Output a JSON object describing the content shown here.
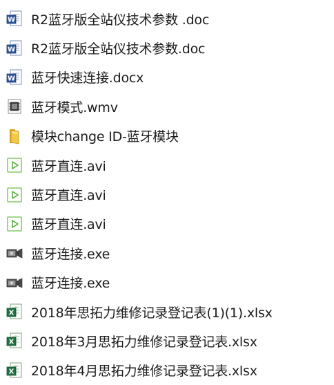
{
  "files": [
    {
      "name": "R2蓝牙版全站仪技术参数 .doc",
      "icon": "word-doc-icon"
    },
    {
      "name": "R2蓝牙版全站仪技术参数.doc",
      "icon": "word-doc-icon"
    },
    {
      "name": "蓝牙快速连接.docx",
      "icon": "word-doc-icon"
    },
    {
      "name": "蓝牙模式.wmv",
      "icon": "video-file-icon"
    },
    {
      "name": "模块change ID-蓝牙模块",
      "icon": "folder-icon"
    },
    {
      "name": "蓝牙直连.avi",
      "icon": "media-play-icon"
    },
    {
      "name": "蓝牙直连.avi",
      "icon": "media-play-icon"
    },
    {
      "name": "蓝牙直连.avi",
      "icon": "media-play-icon"
    },
    {
      "name": "蓝牙连接.exe",
      "icon": "executable-icon"
    },
    {
      "name": "蓝牙连接.exe",
      "icon": "executable-icon"
    },
    {
      "name": "2018年思拓力维修记录登记表(1)(1).xlsx",
      "icon": "excel-sheet-icon"
    },
    {
      "name": "2018年3月思拓力维修记录登记表.xlsx",
      "icon": "excel-sheet-icon"
    },
    {
      "name": "2018年4月思拓力维修记录登记表.xlsx",
      "icon": "excel-sheet-icon"
    }
  ]
}
